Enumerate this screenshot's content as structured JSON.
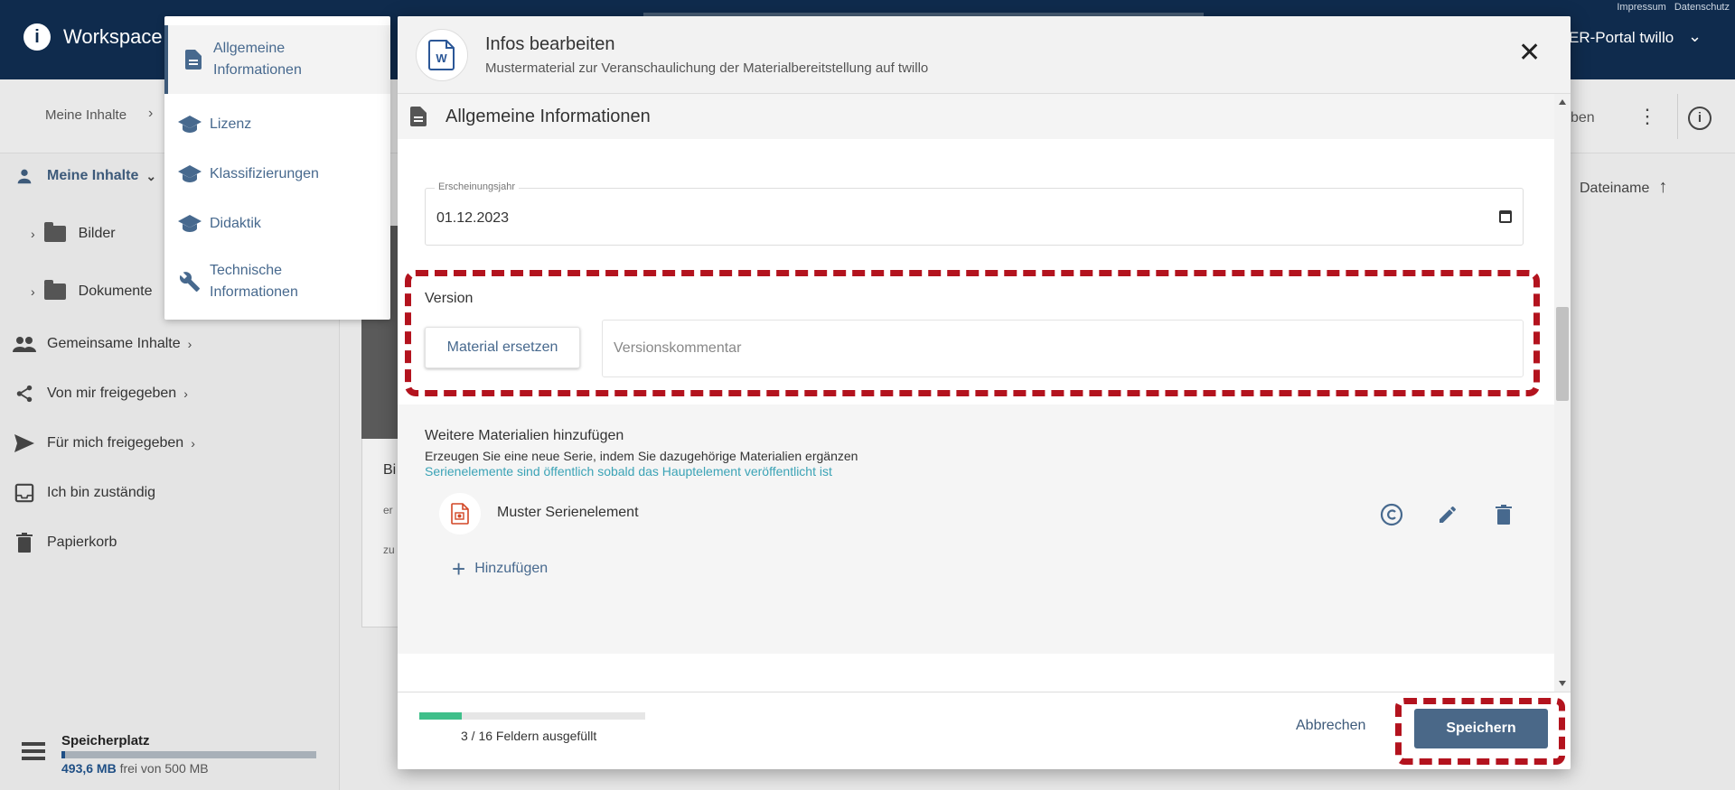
{
  "app": {
    "brand": "Workspace",
    "top_links": [
      "Impressum",
      "Datenschutz"
    ],
    "portal": "ER-Portal twillo"
  },
  "subbar": {
    "breadcrumb": "Meine Inhalte",
    "action_fragment": "ben"
  },
  "sidebar": {
    "my_content": "Meine Inhalte",
    "folders": [
      "Bilder",
      "Dokumente"
    ],
    "items": [
      "Gemeinsame Inhalte",
      "Von mir freigegeben",
      "Für mich freigegeben",
      "Ich bin zuständig",
      "Papierkorb"
    ],
    "storage": {
      "title": "Speicherplatz",
      "used": "493,6 MB",
      "rest": "frei von 500 MB",
      "fill_fraction": 0.013
    }
  },
  "content": {
    "sort_label": "Dateiname",
    "card_fragments": [
      "Bi",
      "er",
      "zu"
    ]
  },
  "section_nav": {
    "items": [
      {
        "label": "Allgemeine Informationen",
        "icon": "document-icon",
        "active": true
      },
      {
        "label": "Lizenz",
        "icon": "graduation-cap-icon",
        "active": false
      },
      {
        "label": "Klassifizierungen",
        "icon": "graduation-cap-icon",
        "active": false
      },
      {
        "label": "Didaktik",
        "icon": "graduation-cap-icon",
        "active": false
      },
      {
        "label": "Technische Informationen",
        "icon": "wrench-icon",
        "active": false
      }
    ]
  },
  "dialog": {
    "title": "Infos bearbeiten",
    "subtitle": "Mustermaterial zur Veranschaulichung der Materialbereitstellung auf twillo",
    "section_title": "Allgemeine Informationen",
    "date_field": {
      "label": "Erscheinungsjahr",
      "value": "01.12.2023"
    },
    "version": {
      "label": "Version",
      "replace_button": "Material ersetzen",
      "comment_placeholder": "Versionskommentar"
    },
    "more_materials": {
      "title": "Weitere Materialien hinzufügen",
      "description": "Erzeugen Sie eine neue Serie, indem Sie dazugehörige Materialien ergänzen",
      "note": "Serienelemente sind öffentlich sobald das Hauptelement veröffentlicht ist",
      "items": [
        {
          "name": "Muster Serienelement"
        }
      ],
      "add_button": "Hinzufügen"
    },
    "footer": {
      "progress_text": "3 / 16 Feldern ausgefüllt",
      "progress_fraction": 0.1875,
      "cancel": "Abbrechen",
      "save": "Speichern"
    }
  },
  "colors": {
    "header_navy": "#0f2b4d",
    "accent_blue": "#47698e",
    "save_button": "#4a6888",
    "highlight_red": "#b3131e",
    "progress_green": "#3fbf8a",
    "note_teal": "#3ba3b6"
  }
}
